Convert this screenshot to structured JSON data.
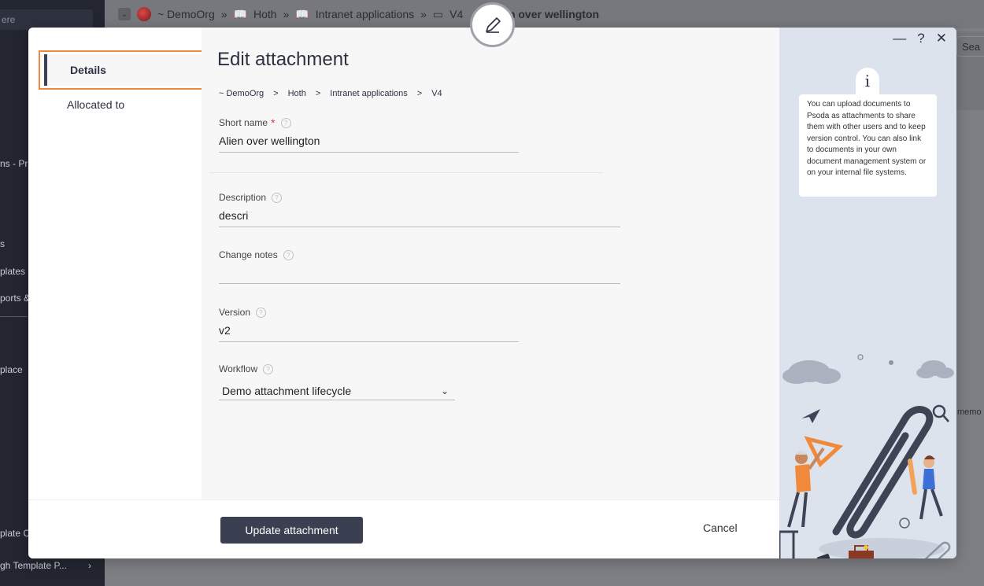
{
  "background": {
    "search_placeholder": "ere",
    "sidebar_items": [
      "ns - Pro",
      "s",
      "plates",
      "ports &",
      "place",
      "plate C",
      "gh Template P..."
    ],
    "breadcrumb": {
      "org": "~ DemoOrg",
      "folder1": "Hoth",
      "folder2": "Intranet applications",
      "version": "V4",
      "current": "ien over wellington"
    },
    "search_partial": "Sea",
    "memo_partial": "memo"
  },
  "modal": {
    "nav": {
      "items": [
        {
          "label": "Details",
          "active": true
        },
        {
          "label": "Allocated to",
          "active": false
        }
      ]
    },
    "title": "Edit attachment",
    "breadcrumb": [
      "~ DemoOrg",
      "Hoth",
      "Intranet applications",
      "V4"
    ],
    "breadcrumb_sep": ">",
    "fields": {
      "short_name": {
        "label": "Short name",
        "value": "Alien over wellington",
        "required": true
      },
      "description": {
        "label": "Description",
        "value": "descri"
      },
      "change_notes": {
        "label": "Change notes",
        "value": ""
      },
      "version": {
        "label": "Version",
        "value": "v2"
      },
      "workflow": {
        "label": "Workflow",
        "value": "Demo attachment lifecycle"
      }
    },
    "footer": {
      "update_label": "Update attachment",
      "cancel_label": "Cancel"
    },
    "info": {
      "icon": "i",
      "text": "You can upload documents to Psoda as attachments to share them with other users and to keep version control. You can also link to documents in your own document management system or on your internal file systems."
    },
    "window_controls": {
      "minimize": "—",
      "help": "?",
      "close": "✕"
    }
  },
  "colors": {
    "accent_primary": "#3a4052",
    "highlight_orange": "#f08a3a",
    "required_red": "#d93a3a",
    "info_panel_bg": "#dde3ec"
  }
}
